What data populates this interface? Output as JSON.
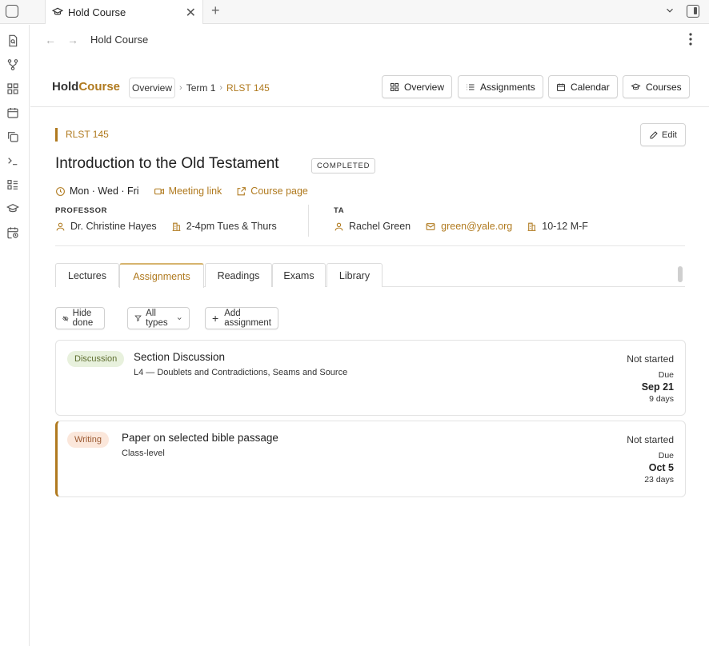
{
  "window": {
    "tab_title": "Hold Course",
    "address_title": "Hold Course"
  },
  "colors": {
    "accent": "#b07a1f",
    "discussion_tag_bg": "#e8f1dd",
    "writing_tag_bg": "#fbe7db"
  },
  "header": {
    "logo_part1": "Hold",
    "logo_part2": "Course",
    "breadcrumb": {
      "root": "Overview",
      "term": "Term 1",
      "current": "RLST 145",
      "separator": "›"
    },
    "nav_buttons": {
      "overview": "Overview",
      "assignments": "Assignments",
      "calendar": "Calendar",
      "courses": "Courses"
    }
  },
  "course": {
    "code": "RLST 145",
    "title": "Introduction to the Old Testament",
    "status": "COMPLETED",
    "edit_label": "Edit",
    "schedule": "Mon · Wed · Fri",
    "meeting_link": "Meeting link",
    "course_page": "Course page"
  },
  "professor": {
    "label": "PROFESSOR",
    "name": "Dr. Christine Hayes",
    "office_hours": "2-4pm Tues & Thurs"
  },
  "ta": {
    "label": "TA",
    "name": "Rachel Green",
    "email": "green@yale.org",
    "office_hours": "10-12 M-F"
  },
  "tabs": {
    "lectures": "Lectures",
    "assignments": "Assignments",
    "readings": "Readings",
    "exams": "Exams",
    "library": "Library",
    "active": "Assignments"
  },
  "filters": {
    "hide_done": "Hide done",
    "all_types": "All types",
    "add_assignment": "Add assignment"
  },
  "assignments": [
    {
      "type": "Discussion",
      "title": "Section Discussion",
      "subtitle": "L4 — Doublets and Contradictions, Seams and Source",
      "status": "Not started",
      "due_label": "Due",
      "due_date": "Sep 21",
      "days": "9 days"
    },
    {
      "type": "Writing",
      "title": "Paper on selected bible passage",
      "subtitle": "Class-level",
      "status": "Not started",
      "due_label": "Due",
      "due_date": "Oct 5",
      "days": "23 days"
    }
  ]
}
